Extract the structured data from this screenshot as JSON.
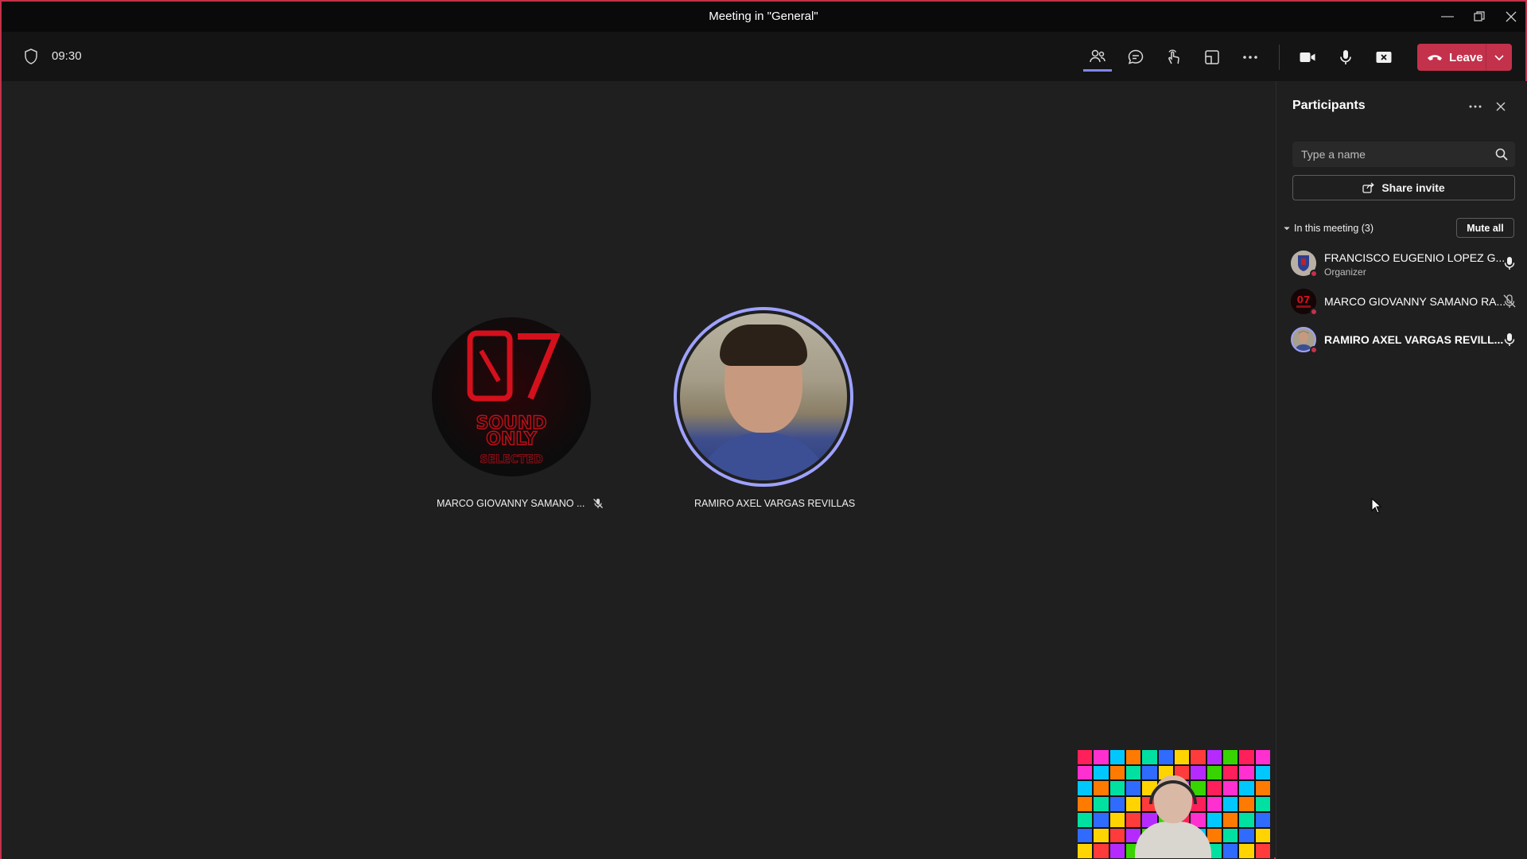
{
  "window": {
    "title": "Meeting in \"General\"",
    "minimize_icon": "minimize-icon",
    "restore_icon": "restore-icon",
    "close_icon": "close-icon"
  },
  "toolbar": {
    "timer": "09:30",
    "icons": [
      "people-icon",
      "chat-icon",
      "reactions-icon",
      "rooms-icon",
      "more-icon",
      "camera-icon",
      "mic-icon",
      "share-screen-icon"
    ],
    "leave_label": "Leave",
    "leave_color": "#c4314b"
  },
  "stage": {
    "tiles": [
      {
        "name": "MARCO GIOVANNY SAMANO ...",
        "muted": true
      },
      {
        "name": "RAMIRO AXEL VARGAS REVILLAS",
        "muted": false,
        "speaking": true
      }
    ],
    "speaking_ring_color": "#9ea2ff"
  },
  "panel": {
    "title": "Participants",
    "search_placeholder": "Type a name",
    "share_label": "Share invite",
    "section_label": "In this meeting (3)",
    "mute_all_label": "Mute all",
    "participants": [
      {
        "name": "FRANCISCO EUGENIO LOPEZ G...",
        "role": "Organizer",
        "mic": "on"
      },
      {
        "name": "MARCO GIOVANNY SAMANO RA...",
        "role": "",
        "mic": "muted"
      },
      {
        "name": "RAMIRO AXEL VARGAS REVILL...",
        "role": "",
        "mic": "on"
      }
    ]
  }
}
